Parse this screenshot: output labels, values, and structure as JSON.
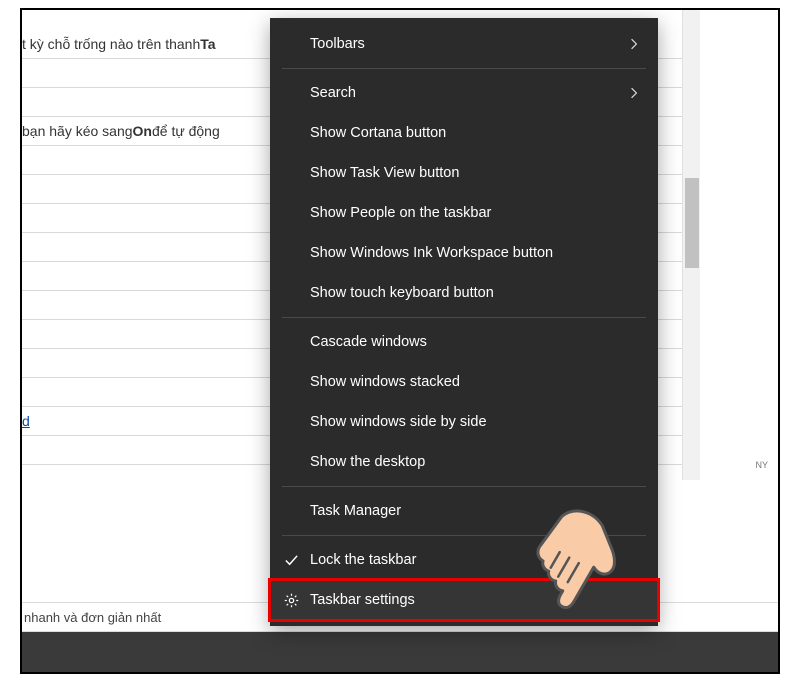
{
  "document": {
    "line1_prefix": "t kỳ chỗ trống nào trên thanh ",
    "line1_bold": "Ta",
    "line2_prefix": "bạn hãy kéo sang ",
    "line2_bold": "On",
    "line2_suffix": " để tự động",
    "link_text": "d",
    "footer_text": "nhanh và đơn giản nhất"
  },
  "right_badge": "NY",
  "menu": {
    "toolbars": "Toolbars",
    "search": "Search",
    "show_cortana": "Show Cortana button",
    "show_task_view": "Show Task View button",
    "show_people": "Show People on the taskbar",
    "show_ink": "Show Windows Ink Workspace button",
    "show_touch_kb": "Show touch keyboard button",
    "cascade": "Cascade windows",
    "stacked": "Show windows stacked",
    "side_by_side": "Show windows side by side",
    "show_desktop": "Show the desktop",
    "task_manager": "Task Manager",
    "lock_taskbar": "Lock the taskbar",
    "taskbar_settings": "Taskbar settings"
  }
}
